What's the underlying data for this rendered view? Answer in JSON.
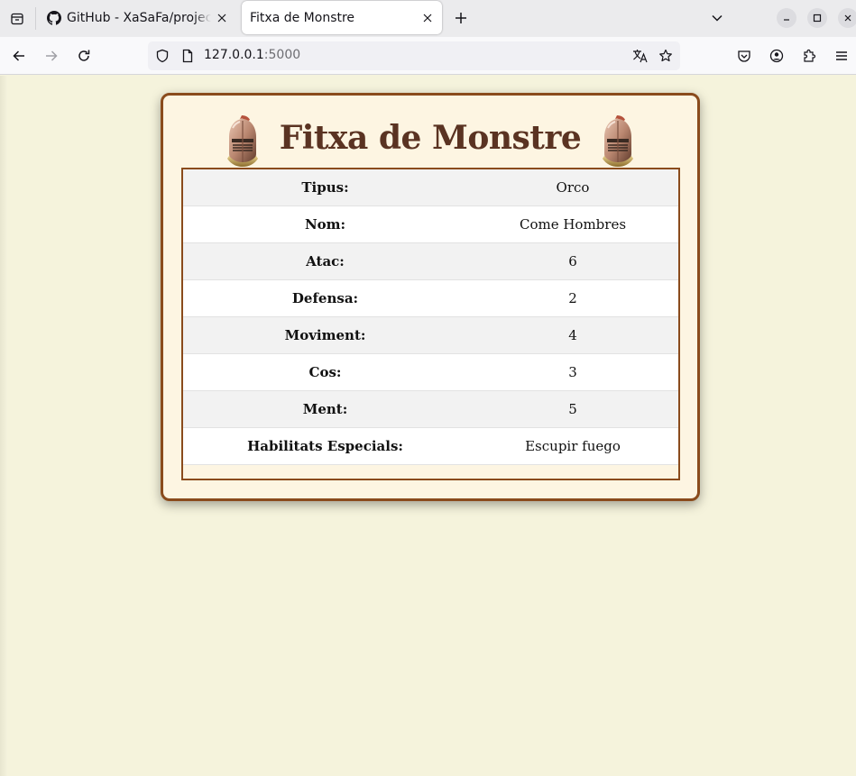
{
  "browser": {
    "tabs": [
      {
        "title": "GitHub - XaSaFa/projecte",
        "active": false,
        "favicon": "github-icon"
      },
      {
        "title": "Fitxa de Monstre",
        "active": true
      }
    ],
    "address": {
      "host": "127.0.0.1",
      "port": ":5000"
    },
    "icons": [
      "tab-list-icon",
      "close-icon",
      "plus-icon",
      "chevron-down-icon",
      "minimize-icon",
      "maximize-icon",
      "back-icon",
      "forward-icon",
      "reload-icon",
      "shield-icon",
      "page-icon",
      "translate-icon",
      "star-icon",
      "pocket-icon",
      "account-icon",
      "extensions-icon",
      "menu-icon"
    ]
  },
  "page": {
    "title": "Fitxa de Monstre",
    "decoration": "knight-helmet-icon",
    "accent_color": "#8a4b1c",
    "background_color": "#f5f3dc",
    "stats": [
      {
        "label": "Tipus:",
        "value": "Orco"
      },
      {
        "label": "Nom:",
        "value": "Come Hombres"
      },
      {
        "label": "Atac:",
        "value": "6"
      },
      {
        "label": "Defensa:",
        "value": "2"
      },
      {
        "label": "Moviment:",
        "value": "4"
      },
      {
        "label": "Cos:",
        "value": "3"
      },
      {
        "label": "Ment:",
        "value": "5"
      },
      {
        "label": "Habilitats Especials:",
        "value": "Escupir fuego"
      }
    ]
  }
}
